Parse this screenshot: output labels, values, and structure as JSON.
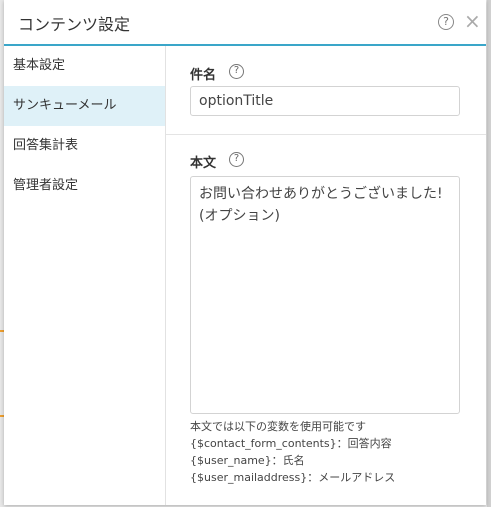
{
  "header": {
    "title": "コンテンツ設定",
    "help_icon": "?",
    "close_icon": "×"
  },
  "sidebar": {
    "items": [
      {
        "label": "基本設定"
      },
      {
        "label": "サンキューメール"
      },
      {
        "label": "回答集計表"
      },
      {
        "label": "管理者設定"
      }
    ],
    "active_index": 1
  },
  "form": {
    "subject_label": "件名",
    "subject_value": "optionTitle",
    "body_label": "本文",
    "body_value": "お問い合わせありがとうございました!\n(オプション)",
    "help_icon": "?",
    "help_lines": [
      "本文では以下の変数を使用可能です",
      "{$contact_form_contents}：回答内容",
      "{$user_name}：氏名",
      "{$user_mailaddress}：メールアドレス"
    ]
  },
  "colors": {
    "accent": "#3aa6c9",
    "active_item_bg": "#dff1f8"
  }
}
